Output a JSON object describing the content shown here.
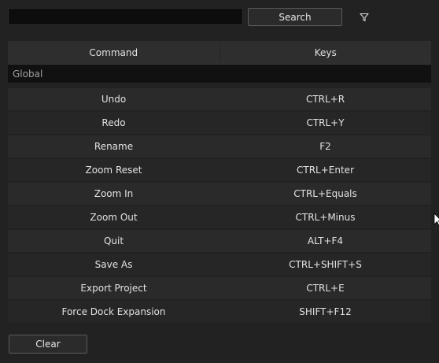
{
  "search": {
    "value": "",
    "placeholder": "",
    "button_label": "Search"
  },
  "filter": {
    "icon": "filter-icon"
  },
  "table": {
    "headers": {
      "command": "Command",
      "keys": "Keys"
    },
    "group": "Global",
    "rows": [
      {
        "command": "Undo",
        "keys": "CTRL+R"
      },
      {
        "command": "Redo",
        "keys": "CTRL+Y"
      },
      {
        "command": "Rename",
        "keys": "F2"
      },
      {
        "command": "Zoom Reset",
        "keys": "CTRL+Enter"
      },
      {
        "command": "Zoom In",
        "keys": "CTRL+Equals"
      },
      {
        "command": "Zoom Out",
        "keys": "CTRL+Minus"
      },
      {
        "command": "Quit",
        "keys": "ALT+F4"
      },
      {
        "command": "Save As",
        "keys": "CTRL+SHIFT+S"
      },
      {
        "command": "Export Project",
        "keys": "CTRL+E"
      },
      {
        "command": "Force Dock Expansion",
        "keys": "SHIFT+F12"
      }
    ]
  },
  "footer": {
    "clear_label": "Clear"
  },
  "colors": {
    "background": "#222222",
    "input_bg": "#0d0d0d",
    "row_bg": "#2a2a2a",
    "group_bg": "#111111"
  }
}
